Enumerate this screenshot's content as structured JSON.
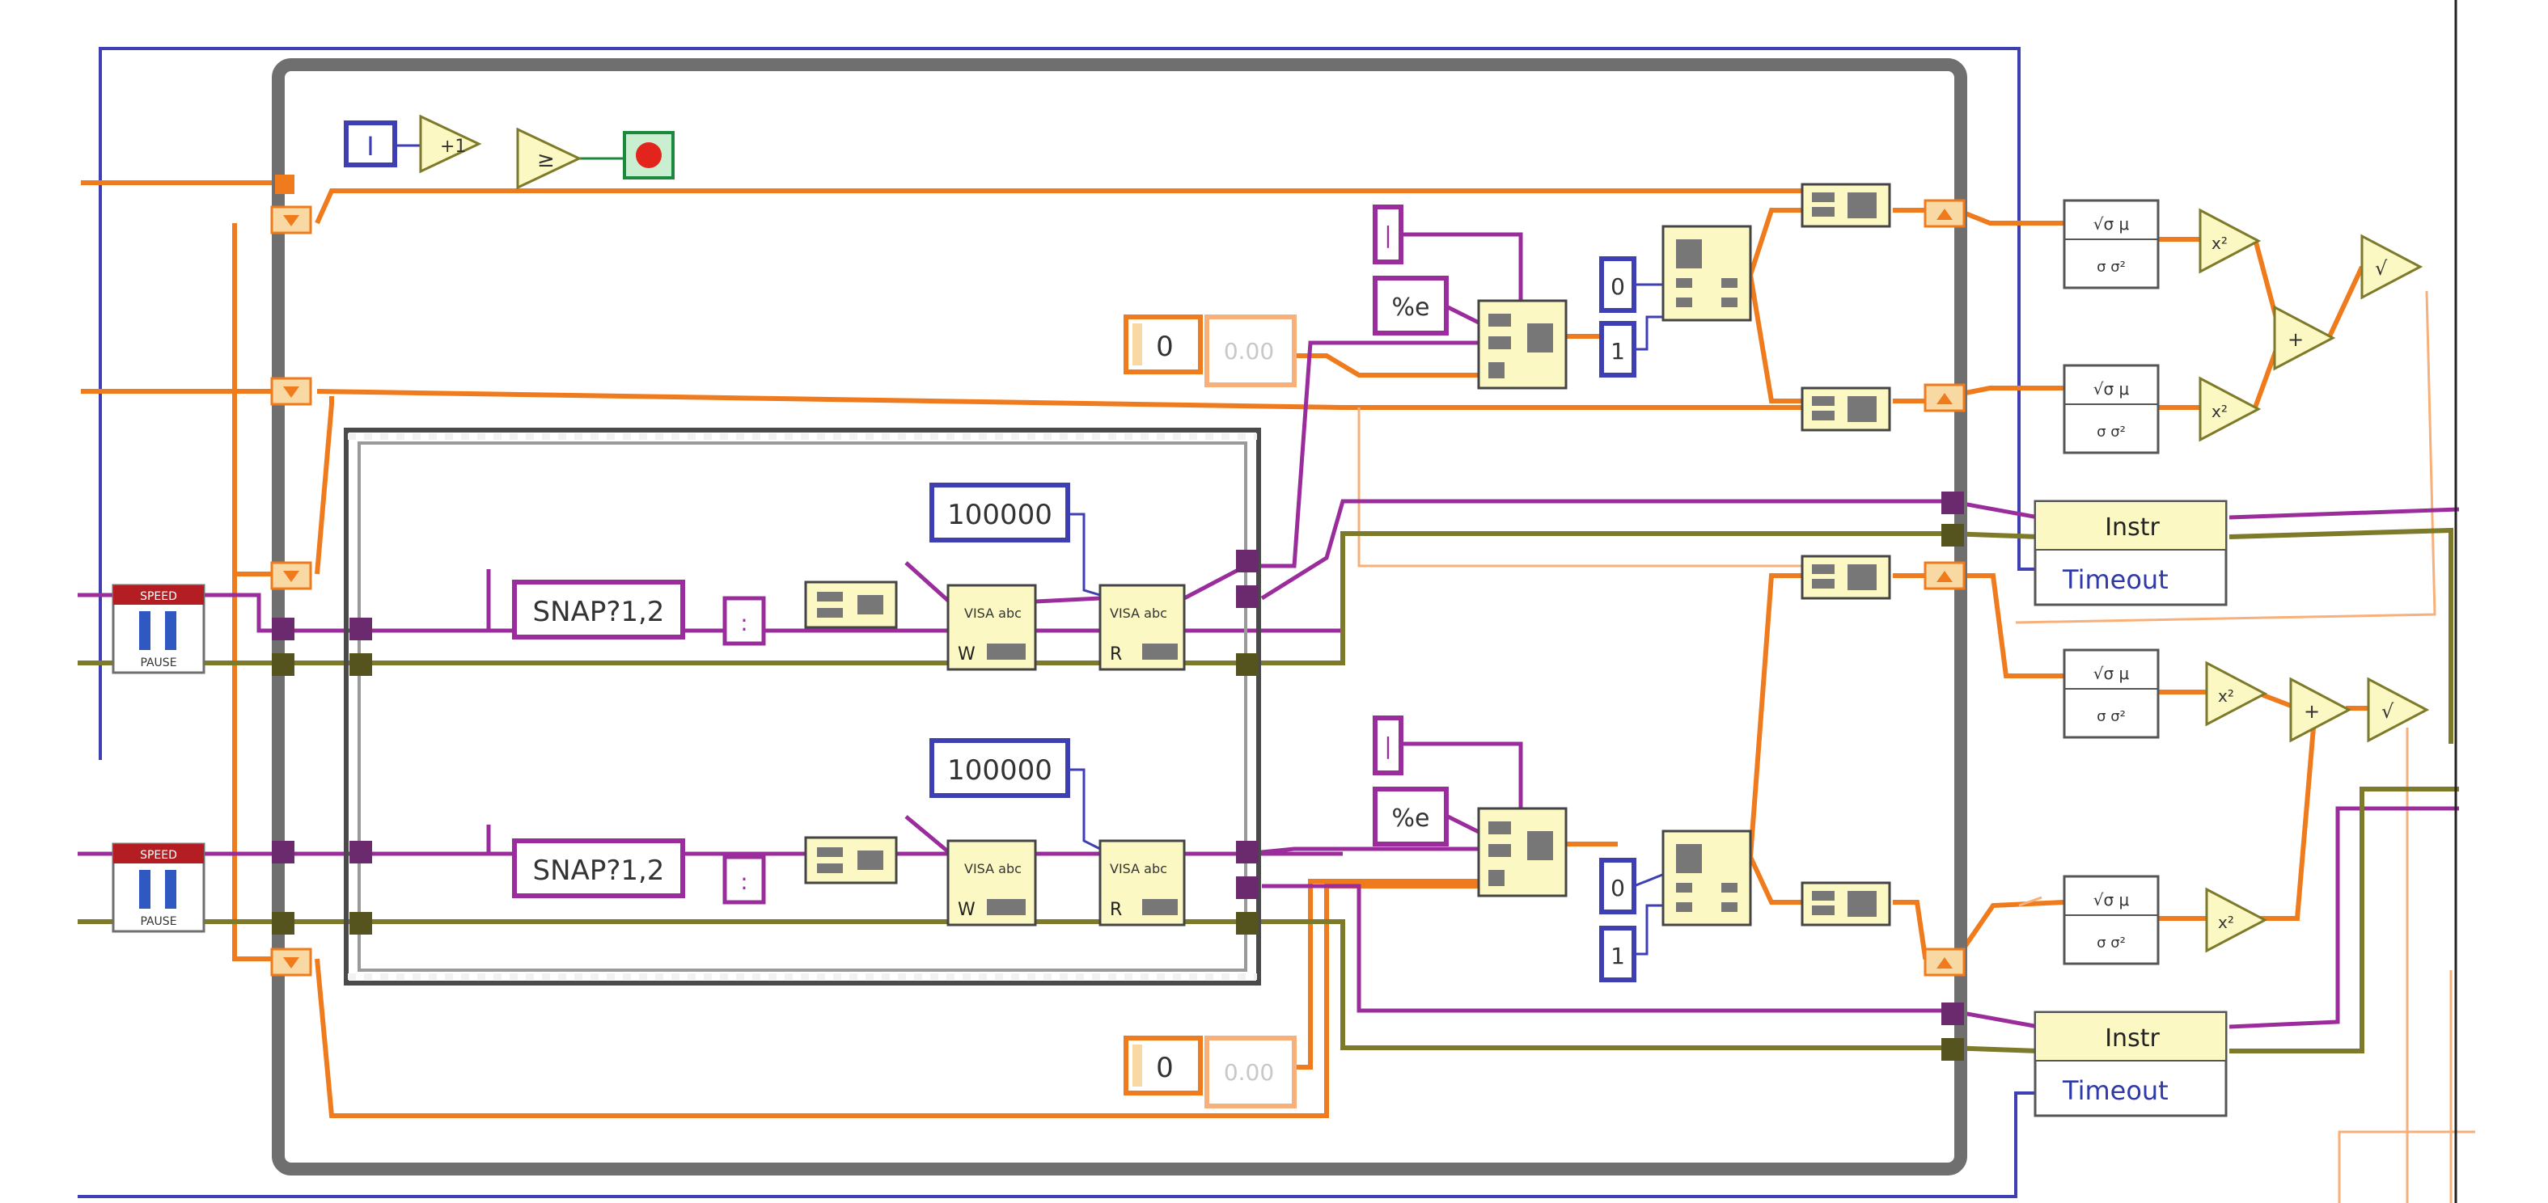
{
  "diagram": {
    "stop_constant": "I",
    "timeout_constant": "100000",
    "command_string": "SNAP?1,2",
    "format_string": "%e",
    "separator_string": "|",
    "delimiter_label": ":",
    "index_zero": "0",
    "index_one": "1",
    "numeric_zero": "0",
    "numeric_float": "0.00",
    "pause_label": "PAUSE",
    "pause_header": "SPEED",
    "visa_read_top": "VISA abc",
    "visa_write_top": "VISA abc",
    "visa_write_code": "W",
    "visa_read_code": "R",
    "instr_label": "Instr",
    "timeout_label": "Timeout",
    "stddev_top": "√σ μ",
    "stddev_bottom": "σ σ²",
    "square_label": "x²",
    "sqrt_label": "√",
    "add_label": "+",
    "increment_label": "+1",
    "greater_label": "≥",
    "wire_colors": {
      "numeric": "#f07b1d",
      "string": "#9a2d9b",
      "error": "#7d7a2a",
      "integer": "#3d3fb3",
      "frame": "#6f6f6f",
      "node_fill": "#fbf8c4"
    }
  }
}
